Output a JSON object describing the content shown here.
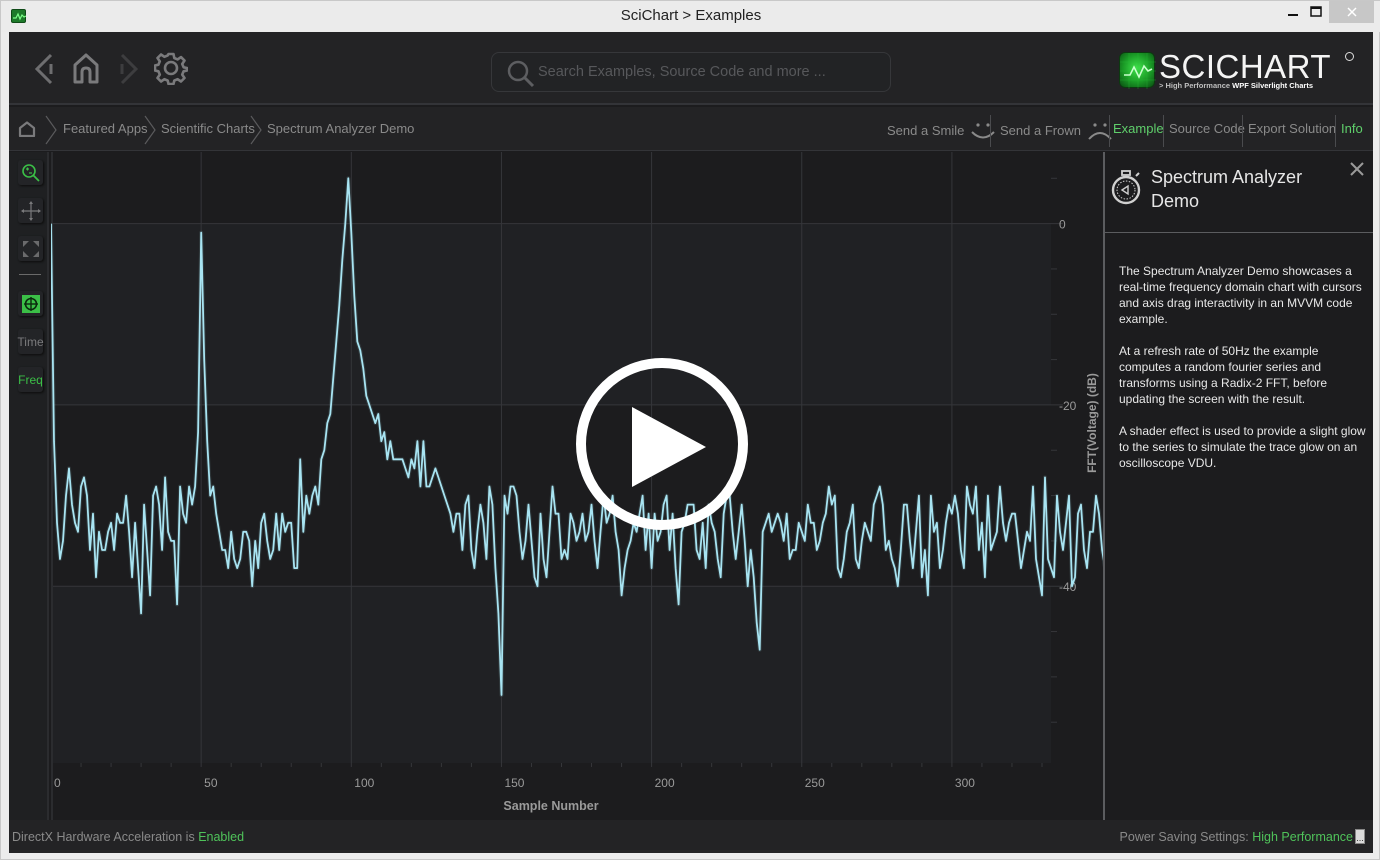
{
  "window": {
    "title": "SciChart > Examples",
    "controls": [
      "minimize",
      "maximize",
      "close"
    ]
  },
  "topbar": {
    "nav_icons": [
      "back-icon",
      "home-icon",
      "forward-icon",
      "settings-icon"
    ],
    "search": {
      "placeholder": "Search Examples, Source Code and more ...",
      "value": ""
    },
    "logo": {
      "name": "SCICHART",
      "tagline_prefix": "> High Performance ",
      "tagline_bold": "WPF Silverlight Charts"
    }
  },
  "breadcrumb": {
    "items": [
      "Featured Apps",
      "Scientific Charts",
      "Spectrum Analyzer Demo"
    ],
    "actions": [
      {
        "label": "Send a Smile",
        "icon": "smile-icon",
        "active": false
      },
      {
        "label": "Send a Frown",
        "icon": "frown-icon",
        "active": false
      },
      {
        "label": "Example",
        "active": true
      },
      {
        "label": "Source Code",
        "active": false
      },
      {
        "label": "Export Solution",
        "active": false
      },
      {
        "label": "Info",
        "active": true
      }
    ]
  },
  "toolbar": {
    "items": [
      {
        "name": "zoom-tool",
        "icon": "zoom-icon",
        "active": true
      },
      {
        "name": "pan-tool",
        "icon": "pan-icon",
        "active": false
      },
      {
        "name": "zoom-extents-tool",
        "icon": "zoom-extents-icon",
        "active": false
      },
      {
        "name": "cursor-tool",
        "icon": "crosshair-icon",
        "active": true
      },
      {
        "name": "time-mode",
        "label": "Time",
        "active": false
      },
      {
        "name": "freq-mode",
        "label": "Freq",
        "active": true
      }
    ]
  },
  "info_panel": {
    "title": "Spectrum Analyzer Demo",
    "paragraphs": [
      "The Spectrum Analyzer Demo showcases a real-time frequency domain chart with cursors and axis drag interactivity in an MVVM code example.",
      "At a refresh rate of 50Hz the example computes a random fourier series and transforms using a Radix-2 FFT, before updating the screen with the result.",
      "A shader effect is used to provide a slight glow to the series to simulate the trace glow on an oscilloscope VDU."
    ]
  },
  "status": {
    "left_prefix": "DirectX Hardware Acceleration is ",
    "left_value": "Enabled",
    "right_prefix": "Power Saving Settings: ",
    "right_value": "High Performance",
    "more_button": "..."
  },
  "colors": {
    "accent_green": "#4fc35a",
    "series": "#a8e4f2",
    "background": "#1c1c1e"
  },
  "chart_data": {
    "type": "line",
    "title": "",
    "xlabel": "Sample Number",
    "ylabel": "FFT(Voltage) (dB)",
    "xlim": [
      0,
      333
    ],
    "ylim": [
      -59.5,
      7.9
    ],
    "x_ticks": [
      0,
      50,
      100,
      150,
      200,
      250,
      300
    ],
    "y_ticks": [
      0,
      -20,
      -40
    ],
    "y_axis_side": "right",
    "grid": true,
    "legend": "none",
    "series": [
      {
        "name": "FFT",
        "x_start": 0,
        "x_step": 1,
        "values": [
          0,
          -24,
          -33,
          -37,
          -35,
          -30,
          -27,
          -31,
          -33,
          -34,
          -29,
          -28,
          -30,
          -36,
          -32,
          -39,
          -34,
          -36,
          -36,
          -34,
          -33,
          -36,
          -32,
          -33,
          -33,
          -30,
          -34,
          -39,
          -33,
          -38,
          -43,
          -31,
          -36,
          -41,
          -30,
          -29,
          -31,
          -36,
          -28,
          -34,
          -35,
          -35,
          -42,
          -29,
          -32,
          -33,
          -29,
          -31,
          -29,
          -23,
          -1,
          -15,
          -24,
          -30,
          -29,
          -32,
          -34,
          -36,
          -36,
          -38,
          -34,
          -37,
          -38,
          -37,
          -34,
          -34,
          -35,
          -40,
          -35,
          -38,
          -33,
          -32,
          -35,
          -37,
          -36,
          -32,
          -36,
          -32,
          -34,
          -33,
          -33,
          -38,
          -38,
          -26,
          -34,
          -30,
          -32,
          -30,
          -29,
          -31,
          -26,
          -25,
          -22,
          -21,
          -17,
          -13,
          -9,
          -4,
          0,
          5,
          -1,
          -8,
          -13,
          -14,
          -16,
          -19,
          -20,
          -21,
          -22,
          -21,
          -24,
          -23,
          -26,
          -24,
          -26,
          -26,
          -26,
          -26,
          -27,
          -28,
          -26,
          -27,
          -24,
          -29,
          -24,
          -29,
          -29,
          -28,
          -27,
          -28,
          -29,
          -30,
          -31,
          -32,
          -34,
          -32,
          -32,
          -36,
          -31,
          -30,
          -36,
          -38,
          -34,
          -31,
          -33,
          -37,
          -29,
          -31,
          -38,
          -43,
          -52,
          -30,
          -32,
          -29,
          -29,
          -30,
          -34,
          -37,
          -35,
          -31,
          -35,
          -39,
          -40,
          -32,
          -37,
          -39,
          -34,
          -29,
          -32,
          -32,
          -37,
          -36,
          -37,
          -32,
          -33,
          -35,
          -34,
          -32,
          -35,
          -34,
          -31,
          -35,
          -38,
          -34,
          -30,
          -33,
          -32,
          -30,
          -34,
          -36,
          -41,
          -38,
          -36,
          -35,
          -33,
          -34,
          -32,
          -30,
          -36,
          -32,
          -38,
          -32,
          -35,
          -34,
          -31,
          -30,
          -36,
          -32,
          -38,
          -42,
          -34,
          -33,
          -31,
          -31,
          -31,
          -36,
          -37,
          -33,
          -38,
          -31,
          -33,
          -34,
          -37,
          -39,
          -32,
          -30,
          -30,
          -34,
          -37,
          -34,
          -31,
          -35,
          -40,
          -36,
          -39,
          -44,
          -47,
          -34,
          -33,
          -32,
          -34,
          -33,
          -32,
          -33,
          -35,
          -32,
          -37,
          -36,
          -36,
          -33,
          -34,
          -35,
          -31,
          -33,
          -33,
          -36,
          -35,
          -33,
          -32,
          -29,
          -31,
          -30,
          -38,
          -39,
          -37,
          -34,
          -33,
          -31,
          -37,
          -38,
          -35,
          -33,
          -34,
          -35,
          -31,
          -30,
          -29,
          -31,
          -36,
          -35,
          -37,
          -38,
          -40,
          -36,
          -31,
          -31,
          -35,
          -38,
          -34,
          -30,
          -39,
          -36,
          -41,
          -30,
          -34,
          -33,
          -38,
          -36,
          -33,
          -31,
          -32,
          -30,
          -32,
          -36,
          -38,
          -29,
          -31,
          -32,
          -29,
          -36,
          -33,
          -39,
          -30,
          -36,
          -35,
          -34,
          -29,
          -33,
          -35,
          -33,
          -32,
          -32,
          -35,
          -38,
          -36,
          -34,
          -35,
          -29,
          -37,
          -39,
          -41,
          -28,
          -37,
          -38,
          -39,
          -30,
          -34,
          -36,
          -33,
          -30,
          -40,
          -39,
          -32,
          -31,
          -36,
          -38,
          -34,
          -34,
          -30,
          -32,
          -36,
          -38,
          -31,
          -33,
          -31
        ]
      }
    ]
  }
}
